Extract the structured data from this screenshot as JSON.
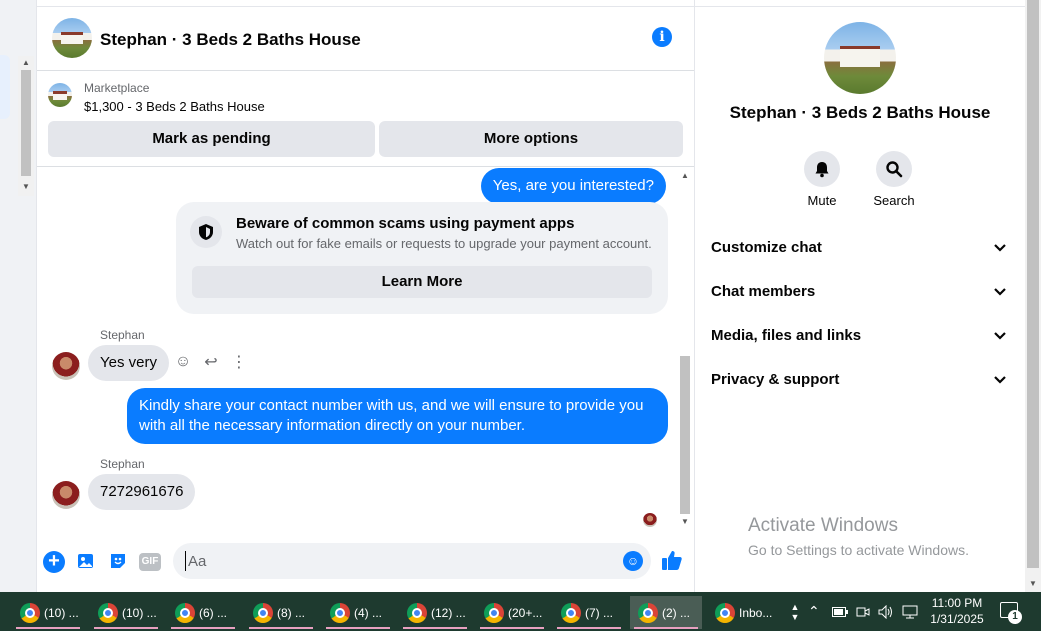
{
  "header": {
    "title": "Stephan · 3 Beds 2 Baths House",
    "icons": [
      "house-avatar",
      "info-icon"
    ]
  },
  "marketplace": {
    "label": "Marketplace",
    "listing": "$1,300 - 3 Beds 2 Baths House",
    "pending_button": "Mark as pending",
    "more_button": "More options"
  },
  "messages": {
    "out1": "Yes, are you interested?",
    "scam_title": "Beware of common scams using payment apps",
    "scam_sub": "Watch out for fake emails or requests to upgrade your payment account.",
    "learn_more": "Learn More",
    "sender1": "Stephan",
    "in1": "Yes very",
    "out2": "Kindly share your contact number with us, and we will ensure to provide you with all the necessary information directly on your number.",
    "sender2": "Stephan",
    "in2": "7272961676"
  },
  "composer": {
    "placeholder": "Aa",
    "gif_label": "GIF"
  },
  "panel": {
    "title": "Stephan · 3 Beds 2 Baths House",
    "mute_label": "Mute",
    "search_label": "Search",
    "rows": [
      "Customize chat",
      "Chat members",
      "Media, files and links",
      "Privacy & support"
    ]
  },
  "watermark": {
    "line1": "Activate Windows",
    "line2": "Go to Settings to activate Windows."
  },
  "taskbar": {
    "items": [
      "(10) ...",
      "(10) ...",
      "(6) ...",
      "(8) ...",
      "(4) ...",
      "(12) ...",
      "(20+...",
      "(7) ...",
      "(2) ...",
      "Inbo..."
    ],
    "time": "11:00 PM",
    "date": "1/31/2025",
    "notif_count": "1"
  },
  "colors": {
    "accent": "#0a7cff",
    "bubble_in": "#e4e6eb",
    "taskbar": "#1e3a2f"
  }
}
